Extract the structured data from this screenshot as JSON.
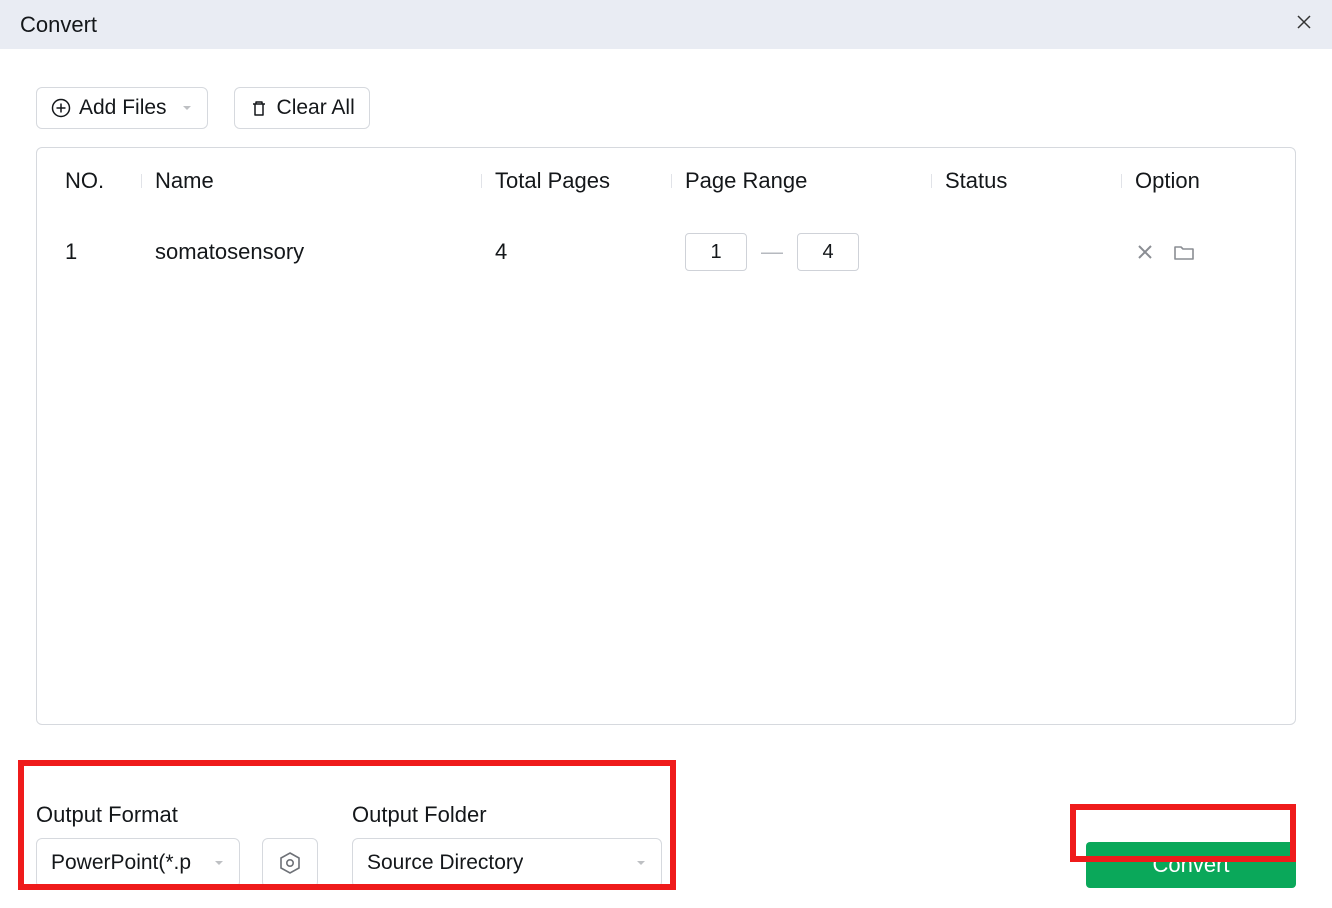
{
  "window": {
    "title": "Convert"
  },
  "toolbar": {
    "add_files_label": "Add Files",
    "clear_all_label": "Clear All"
  },
  "table": {
    "headers": {
      "no": "NO.",
      "name": "Name",
      "total_pages": "Total Pages",
      "page_range": "Page Range",
      "status": "Status",
      "option": "Option"
    },
    "rows": [
      {
        "no": "1",
        "name": "somatosensory",
        "total_pages": "4",
        "range_from": "1",
        "range_to": "4",
        "status": ""
      }
    ]
  },
  "footer": {
    "output_format_label": "Output Format",
    "output_format_value": "PowerPoint(*.p",
    "output_folder_label": "Output Folder",
    "output_folder_value": "Source Directory",
    "convert_label": "Convert"
  },
  "colors": {
    "accent_green": "#0aa85a",
    "highlight_red": "#ef1b1b",
    "titlebar_bg": "#e9ecf3"
  }
}
